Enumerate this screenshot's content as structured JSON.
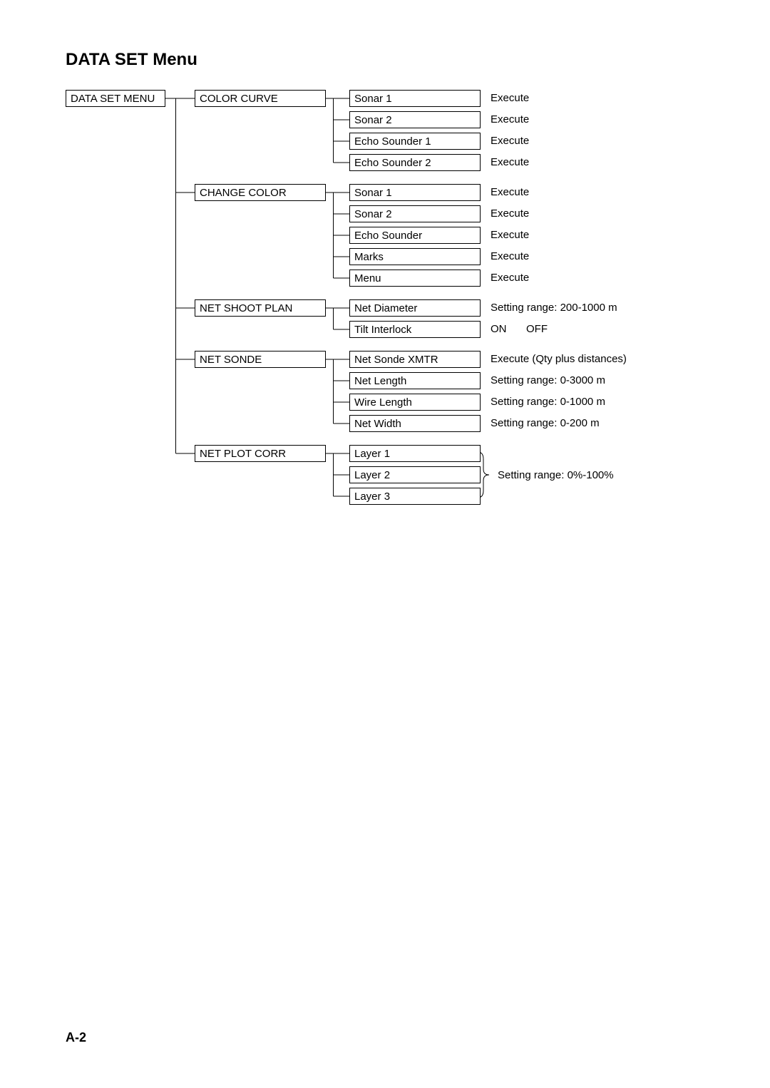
{
  "heading": "DATA SET Menu",
  "root": "DATA SET MENU",
  "groups": [
    {
      "label": "COLOR CURVE",
      "items": [
        {
          "label": "Sonar 1",
          "value": "Execute"
        },
        {
          "label": "Sonar 2",
          "value": "Execute"
        },
        {
          "label": "Echo Sounder 1",
          "value": "Execute"
        },
        {
          "label": "Echo Sounder 2",
          "value": "Execute"
        }
      ]
    },
    {
      "label": "CHANGE COLOR",
      "items": [
        {
          "label": "Sonar 1",
          "value": "Execute"
        },
        {
          "label": "Sonar 2",
          "value": "Execute"
        },
        {
          "label": "Echo Sounder",
          "value": "Execute"
        },
        {
          "label": "Marks",
          "value": "Execute"
        },
        {
          "label": "Menu",
          "value": "Execute"
        }
      ]
    },
    {
      "label": "NET SHOOT PLAN",
      "items": [
        {
          "label": "Net Diameter",
          "value": "Setting range: 200-1000 m"
        },
        {
          "label": "Tilt Interlock",
          "value": "ON",
          "value2": "OFF"
        }
      ]
    },
    {
      "label": "NET SONDE",
      "items": [
        {
          "label": "Net Sonde XMTR",
          "value": "Execute (Qty plus distances)"
        },
        {
          "label": "Net Length",
          "value": "Setting range: 0-3000 m"
        },
        {
          "label": "Wire Length",
          "value": "Setting range: 0-1000 m"
        },
        {
          "label": "Net Width",
          "value": "Setting range: 0-200 m"
        }
      ]
    },
    {
      "label": "NET PLOT CORR",
      "items": [
        {
          "label": "Layer 1"
        },
        {
          "label": "Layer 2"
        },
        {
          "label": "Layer 3"
        }
      ],
      "shared_value": "Setting range: 0%-100%"
    }
  ],
  "page_number": "A-2"
}
